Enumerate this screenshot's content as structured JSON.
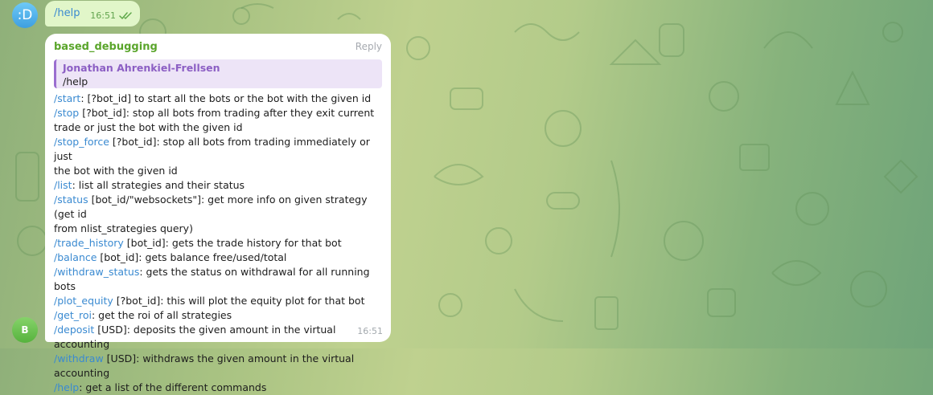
{
  "outgoing": {
    "avatar_text": ":D",
    "text": "/help",
    "time": "16:51",
    "status_icon": "double-check-icon"
  },
  "incoming": {
    "avatar_text": "B",
    "sender": "based_debugging",
    "reply_label": "Reply",
    "quote": {
      "author": "Jonathan Ahrenkiel-Frellsen",
      "text": "/help"
    },
    "time": "16:51",
    "lines": [
      {
        "cmd": "/start",
        "text": ": [?bot_id] to start all the bots or the bot with the given id"
      },
      {
        "cmd": "/stop",
        "text": " [?bot_id]: stop all bots from trading after they exit current"
      },
      {
        "cmd": "",
        "text": "trade or just the bot with the given id"
      },
      {
        "cmd": "/stop_force",
        "text": " [?bot_id]: stop all bots from trading immediately or just"
      },
      {
        "cmd": "",
        "text": "the bot with the given id"
      },
      {
        "cmd": "/list",
        "text": ": list all strategies and their status"
      },
      {
        "cmd": "/status",
        "text": " [bot_id/\"websockets\"]: get more info on given strategy (get id"
      },
      {
        "cmd": "",
        "text": "from nlist_strategies query)"
      },
      {
        "cmd": "/trade_history",
        "text": " [bot_id]: gets the trade history for that bot"
      },
      {
        "cmd": "/balance",
        "text": " [bot_id]: gets balance free/used/total"
      },
      {
        "cmd": "/withdraw_status",
        "text": ": gets the status on withdrawal for all running bots"
      },
      {
        "cmd": "/plot_equity",
        "text": " [?bot_id]: this will plot the equity plot for that bot"
      },
      {
        "cmd": "/get_roi",
        "text": ": get the roi of all strategies"
      },
      {
        "cmd": "/deposit",
        "text": " [USD]: deposits the given amount in the virtual accounting"
      },
      {
        "cmd": "/withdraw",
        "text": " [USD]: withdraws the given amount in the virtual"
      },
      {
        "cmd": "",
        "text": "accounting"
      },
      {
        "cmd": "/help",
        "text": ": get a list of the different commands"
      }
    ]
  },
  "colors": {
    "link": "#3a8ad1",
    "sender": "#5aa52b",
    "quote_author": "#8c5fc4",
    "outgoing_bubble": "#e1f6c9"
  }
}
